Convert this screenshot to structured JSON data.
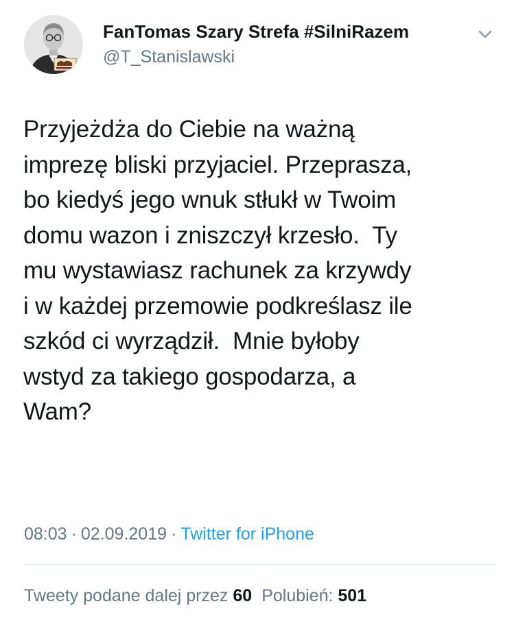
{
  "author": {
    "display_name": "FanTomas Szary Strefa #SilniRazem",
    "handle": "@T_Stanislawski",
    "avatar_icon": "avatar-photo"
  },
  "tweet": {
    "lines": [
      "Przyjeżdża do Ciebie na ważną",
      "imprezę bliski przyjaciel. Przeprasza,",
      "bo kiedyś jego wnuk stłukł w Twoim",
      "domu wazon i zniszczył krzesło.  Ty",
      "mu wystawiasz rachunek za krzywdy",
      "i w każdej przemowie podkreślasz ile",
      "szkód ci wyrządził.  Mnie byłoby",
      "wstyd za takiego gospodarza, a",
      "Wam?"
    ]
  },
  "meta": {
    "time": "08:03",
    "separator": "·",
    "date": "02.09.2019",
    "source": "Twitter for iPhone"
  },
  "stats": {
    "retweets_label": "Tweety podane dalej przez",
    "retweets_count": "60",
    "likes_label": "Polubień:",
    "likes_count": "501"
  },
  "colors": {
    "text": "#14171a",
    "secondary": "#657786",
    "link": "#1da1f2",
    "divider": "#e1e8ed"
  }
}
